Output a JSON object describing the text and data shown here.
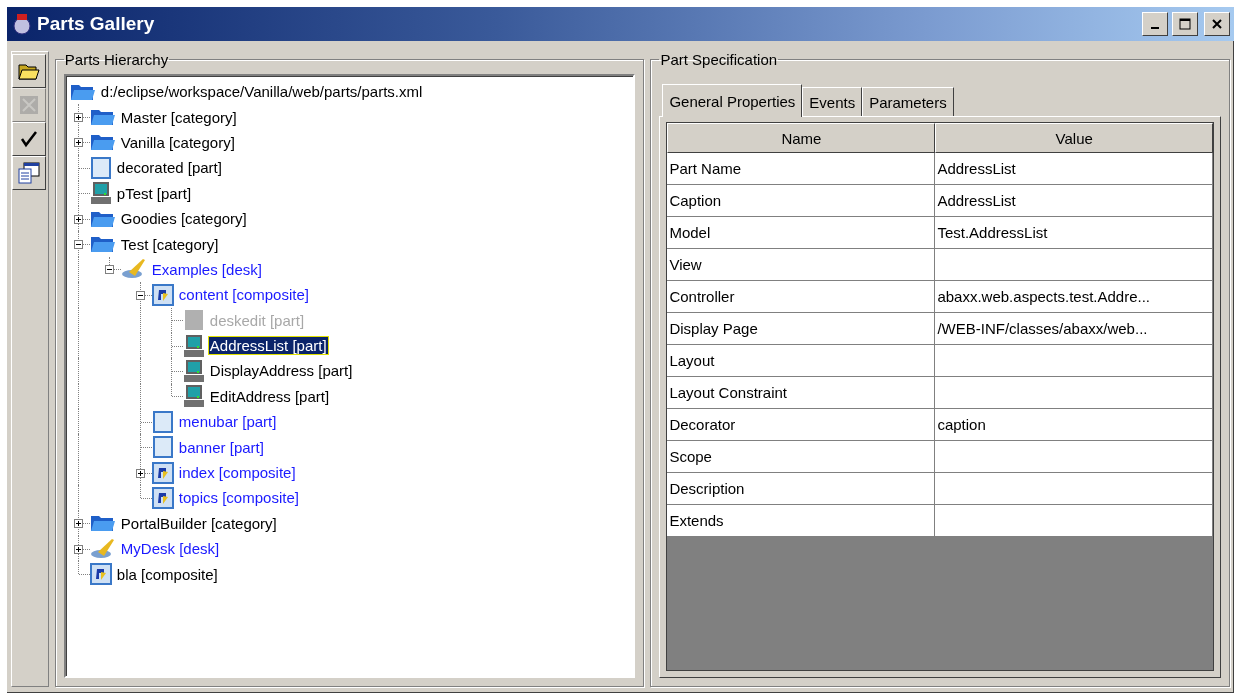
{
  "window": {
    "title": "Parts Gallery"
  },
  "toolbar": [
    {
      "kind": "open",
      "disabled": false
    },
    {
      "kind": "save",
      "disabled": true
    },
    {
      "kind": "check",
      "disabled": false
    },
    {
      "kind": "windows",
      "disabled": false
    }
  ],
  "hierarchy": {
    "title": "Parts Hierarchy",
    "root": {
      "label": "d:/eclipse/workspace/Vanilla/web/parts/parts.xml",
      "kind": "folder",
      "selected": false,
      "disabled": false,
      "children": [
        {
          "label": "Master [category]",
          "kind": "folder",
          "expanded": false,
          "selected": false,
          "disabled": false
        },
        {
          "label": "Vanilla [category]",
          "kind": "folder",
          "expanded": false,
          "selected": false,
          "disabled": false
        },
        {
          "label": "decorated [part]",
          "kind": "page",
          "selected": false,
          "disabled": false
        },
        {
          "label": "pTest [part]",
          "kind": "computer",
          "selected": false,
          "disabled": false
        },
        {
          "label": "Goodies [category]",
          "kind": "folder",
          "expanded": false,
          "selected": false,
          "disabled": false
        },
        {
          "label": "Test [category]",
          "kind": "folder",
          "expanded": true,
          "selected": false,
          "disabled": false,
          "children": [
            {
              "label": "Examples [desk]",
              "kind": "desk",
              "expanded": true,
              "selected": false,
              "disabled": false,
              "color": "#1a1aff",
              "children": [
                {
                  "label": "content [composite]",
                  "kind": "composite",
                  "expanded": true,
                  "selected": false,
                  "disabled": false,
                  "color": "#1a1aff",
                  "children": [
                    {
                      "label": "deskedit [part]",
                      "kind": "computer",
                      "selected": false,
                      "disabled": true
                    },
                    {
                      "label": "AddressList [part]",
                      "kind": "computer",
                      "selected": true,
                      "disabled": false
                    },
                    {
                      "label": "DisplayAddress [part]",
                      "kind": "computer",
                      "selected": false,
                      "disabled": false
                    },
                    {
                      "label": "EditAddress [part]",
                      "kind": "computer",
                      "selected": false,
                      "disabled": false
                    }
                  ]
                },
                {
                  "label": "menubar [part]",
                  "kind": "page",
                  "selected": false,
                  "disabled": false,
                  "color": "#1a1aff"
                },
                {
                  "label": "banner [part]",
                  "kind": "page",
                  "selected": false,
                  "disabled": false,
                  "color": "#1a1aff"
                },
                {
                  "label": "index [composite]",
                  "kind": "composite",
                  "expanded": false,
                  "selected": false,
                  "disabled": false,
                  "color": "#1a1aff"
                },
                {
                  "label": "topics [composite]",
                  "kind": "composite",
                  "selected": false,
                  "disabled": false,
                  "color": "#1a1aff"
                }
              ]
            }
          ]
        },
        {
          "label": "PortalBuilder [category]",
          "kind": "folder",
          "expanded": false,
          "selected": false,
          "disabled": false
        },
        {
          "label": "MyDesk [desk]",
          "kind": "desk",
          "expanded": false,
          "selected": false,
          "disabled": false,
          "color": "#1a1aff"
        },
        {
          "label": "bla [composite]",
          "kind": "composite",
          "selected": false,
          "disabled": false
        }
      ]
    }
  },
  "specification": {
    "title": "Part Specification",
    "tabs": [
      {
        "label": "General Properties",
        "selected": true
      },
      {
        "label": "Events",
        "selected": false
      },
      {
        "label": "Parameters",
        "selected": false
      }
    ],
    "columns": [
      "Name",
      "Value"
    ],
    "rows": [
      [
        "Part Name",
        "AddressList"
      ],
      [
        "Caption",
        "AddressList"
      ],
      [
        "Model",
        "Test.AddressList"
      ],
      [
        "View",
        ""
      ],
      [
        "Controller",
        "abaxx.web.aspects.test.Addre..."
      ],
      [
        "Display Page",
        "/WEB-INF/classes/abaxx/web..."
      ],
      [
        "Layout",
        ""
      ],
      [
        "Layout Constraint",
        ""
      ],
      [
        "Decorator",
        "caption"
      ],
      [
        "Scope",
        ""
      ],
      [
        "Description",
        ""
      ],
      [
        "Extends",
        ""
      ]
    ]
  }
}
